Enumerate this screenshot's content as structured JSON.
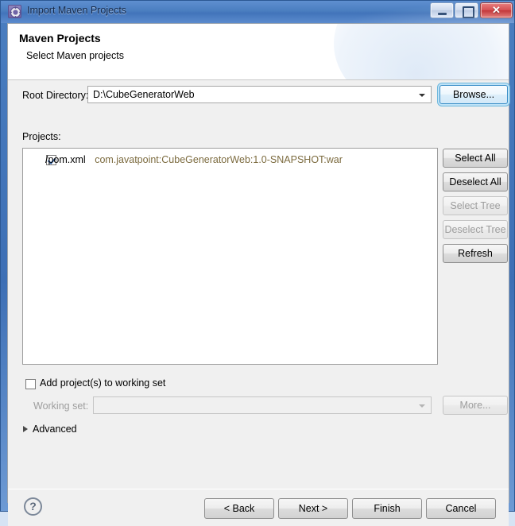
{
  "window": {
    "title": "Import Maven Projects",
    "icon": "maven-gear-icon",
    "minimize_label": "",
    "maximize_label": "",
    "close_label": "✕"
  },
  "banner": {
    "title": "Maven Projects",
    "subtitle": "Select Maven projects"
  },
  "root_directory": {
    "label": "Root Directory:",
    "value": "D:\\CubeGeneratorWeb",
    "browse_label": "Browse..."
  },
  "projects": {
    "label": "Projects:",
    "rows": [
      {
        "checked": true,
        "path": "/pom.xml",
        "coordinates": "com.javatpoint:CubeGeneratorWeb:1.0-SNAPSHOT:war"
      }
    ],
    "buttons": [
      {
        "label": "Select All",
        "enabled": true
      },
      {
        "label": "Deselect All",
        "enabled": true
      },
      {
        "label": "Select Tree",
        "enabled": false
      },
      {
        "label": "Deselect Tree",
        "enabled": false
      },
      {
        "label": "Refresh",
        "enabled": true
      }
    ]
  },
  "working_set": {
    "add_checkbox_label": "Add project(s) to working set",
    "add_checkbox_checked": false,
    "label": "Working set:",
    "value": "",
    "more_label": "More..."
  },
  "advanced": {
    "label": "Advanced",
    "expanded": false
  },
  "footer": {
    "help_label": "?",
    "buttons": [
      {
        "label": "< Back",
        "enabled": true
      },
      {
        "label": "Next >",
        "enabled": true
      },
      {
        "label": "Finish",
        "enabled": true
      },
      {
        "label": "Cancel",
        "enabled": true
      }
    ]
  },
  "colors": {
    "titlebar_blue": "#4a7ec0",
    "close_red": "#bf2b2e",
    "coordinate_text": "#7c6b3f",
    "focus_ring": "#6fb8dd",
    "disabled_text": "#9d9d9d"
  }
}
